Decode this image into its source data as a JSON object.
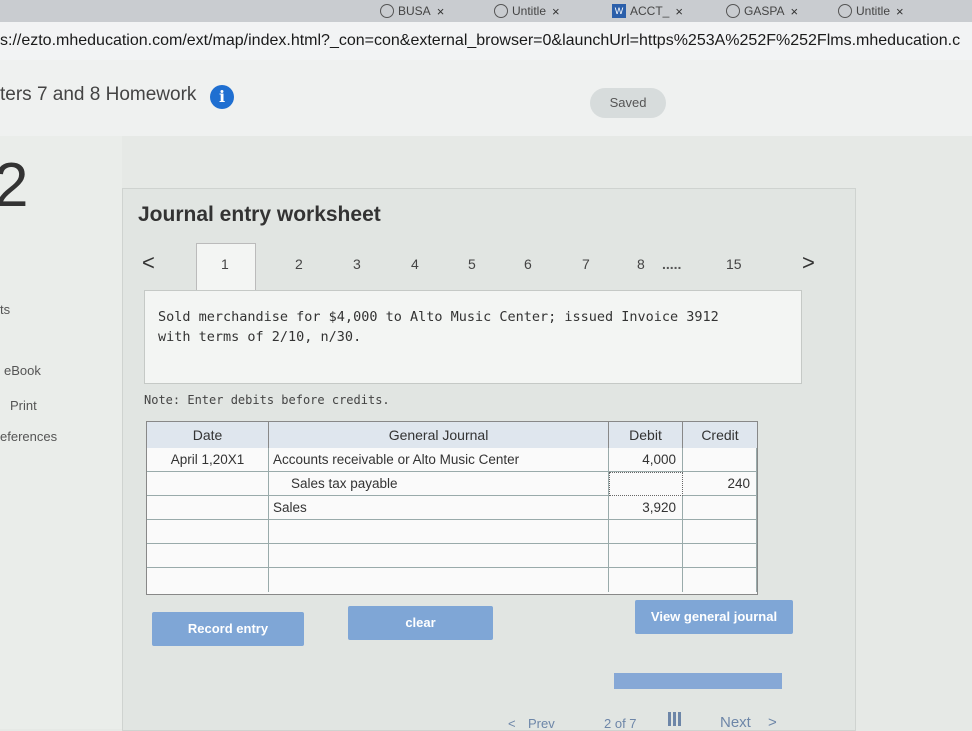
{
  "browser": {
    "tabs": [
      {
        "label": "BUSA",
        "icon": "globe-icon"
      },
      {
        "label": "Untitle",
        "icon": "globe-icon"
      },
      {
        "label": "ACCT_",
        "icon": "word-icon"
      },
      {
        "label": "GASPA",
        "icon": "globe-icon"
      },
      {
        "label": "Untitle",
        "icon": "globe-icon"
      }
    ],
    "close_glyph": "×",
    "word_glyph": "W",
    "url": "s://ezto.mheducation.com/ext/map/index.html?_con=con&external_browser=0&launchUrl=https%253A%252F%252Flms.mheducation.c"
  },
  "header": {
    "title": "ters 7 and 8 Homework",
    "info_glyph": "i",
    "saved_label": "Saved"
  },
  "sidebar": {
    "question_number": "2",
    "items": [
      "ts",
      "eBook",
      "Print",
      "eferences"
    ]
  },
  "worksheet": {
    "title": "Journal entry worksheet",
    "prev_glyph": "<",
    "next_glyph": ">",
    "pages": [
      "1",
      "2",
      "3",
      "4",
      "5",
      "6",
      "7",
      "8",
      ".....",
      "15"
    ],
    "active_page": "1",
    "question": "Sold merchandise for $4,000 to Alto Music Center; issued Invoice 3912 with terms of 2/10, n/30.",
    "note": "Note: Enter debits before credits."
  },
  "journal": {
    "headers": {
      "date": "Date",
      "general_journal": "General Journal",
      "debit": "Debit",
      "credit": "Credit"
    },
    "rows": [
      {
        "date": "April 1,20X1",
        "account": "Accounts receivable or Alto Music Center",
        "debit": "4,000",
        "credit": ""
      },
      {
        "date": "",
        "account": "Sales tax payable",
        "debit": "",
        "credit": "240"
      },
      {
        "date": "",
        "account": "Sales",
        "debit": "3,920",
        "credit": ""
      },
      {
        "date": "",
        "account": "",
        "debit": "",
        "credit": ""
      },
      {
        "date": "",
        "account": "",
        "debit": "",
        "credit": ""
      },
      {
        "date": "",
        "account": "",
        "debit": "",
        "credit": ""
      }
    ]
  },
  "buttons": {
    "record": "Record entry",
    "clear": "clear",
    "view_journal": "View general journal"
  },
  "footer": {
    "prev": "Prev",
    "page": "2 of 7",
    "next": "Next",
    "next_glyph": ">",
    "prev_glyph": "<"
  }
}
